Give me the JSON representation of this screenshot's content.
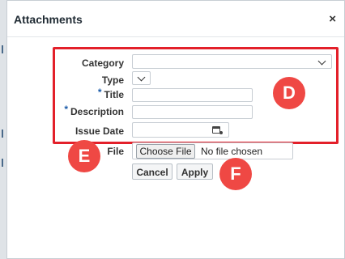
{
  "dialog": {
    "title": "Attachments",
    "close_glyph": "×"
  },
  "form": {
    "category": {
      "label": "Category",
      "value": ""
    },
    "type": {
      "label": "Type",
      "value": ""
    },
    "title": {
      "label": "Title",
      "required_mark": "*",
      "value": ""
    },
    "description": {
      "label": "Description",
      "required_mark": "*",
      "value": ""
    },
    "issue_date": {
      "label": "Issue Date",
      "value": "",
      "icon": "calendar-icon"
    },
    "file": {
      "label": "File",
      "choose_label": "Choose File",
      "status": "No file chosen"
    }
  },
  "buttons": {
    "cancel": "Cancel",
    "apply": "Apply"
  },
  "callouts": {
    "d": "D",
    "e": "E",
    "f": "F"
  },
  "colors": {
    "highlight": "#e3202a",
    "callout": "#ef4844",
    "required": "#1a5aa8"
  }
}
